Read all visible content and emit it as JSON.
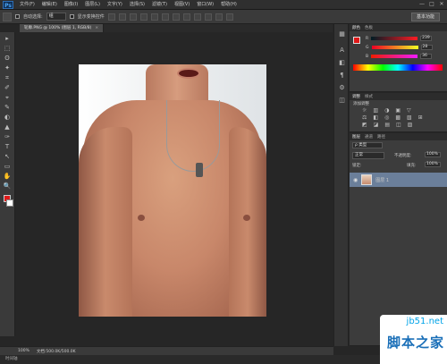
{
  "app": {
    "logo": "Ps"
  },
  "menu": [
    "文件(F)",
    "编辑(E)",
    "图像(I)",
    "图层(L)",
    "文字(Y)",
    "选择(S)",
    "滤镜(T)",
    "视图(V)",
    "窗口(W)",
    "帮助(H)"
  ],
  "window_controls": [
    "—",
    "□",
    "✕"
  ],
  "options_bar": {
    "auto_select_label": "自动选择:",
    "auto_select_value": "组",
    "transform_label": "显示变换控件",
    "workspace_label": "基本功能"
  },
  "document_tab": {
    "title": "轮廓.PNG @ 100% (图层 1, RGB/8)",
    "close": "×"
  },
  "tools": [
    "▸",
    "⬚",
    "ʘ",
    "✦",
    "⌗",
    "✐",
    "⌖",
    "✎",
    "◐",
    "▲",
    "✑",
    "T",
    "↖",
    "▭",
    "✋",
    "🔍"
  ],
  "right_strip_icons": [
    "▦",
    "A",
    "◧",
    "¶",
    "⚙",
    "◫"
  ],
  "color_panel": {
    "tabs": [
      "颜色",
      "色板"
    ],
    "channels": [
      {
        "label": "R",
        "value": "239"
      },
      {
        "label": "G",
        "value": "28"
      },
      {
        "label": "B",
        "value": "36"
      }
    ]
  },
  "adjustments_panel": {
    "tabs": [
      "调整",
      "样式"
    ],
    "title": "添加调整",
    "row1": [
      "☼",
      "▥",
      "◑",
      "▣",
      "▽"
    ],
    "row2": [
      "⚖",
      "◧",
      "◎",
      "▩",
      "▧",
      "⊞"
    ],
    "row3": [
      "◩",
      "◪",
      "▤",
      "◫",
      "▨"
    ]
  },
  "layers_panel": {
    "tabs": [
      "图层",
      "通道",
      "路径"
    ],
    "kind": "ρ 类型",
    "blend_mode": "正常",
    "opacity_label": "不透明度:",
    "opacity_value": "100%",
    "lock_label": "锁定:",
    "fill_label": "填充:",
    "fill_value": "100%",
    "layer_name": "图层 1"
  },
  "status": {
    "zoom": "100%",
    "doc": "文档:500.0K/500.0K"
  },
  "bottom_tab": "时间轴",
  "watermark": {
    "domain": "jb51.net",
    "text": "脚本之家"
  },
  "colors": {
    "foreground": "#e01818",
    "background": "#ffffff",
    "accent": "#6b7f9a"
  }
}
